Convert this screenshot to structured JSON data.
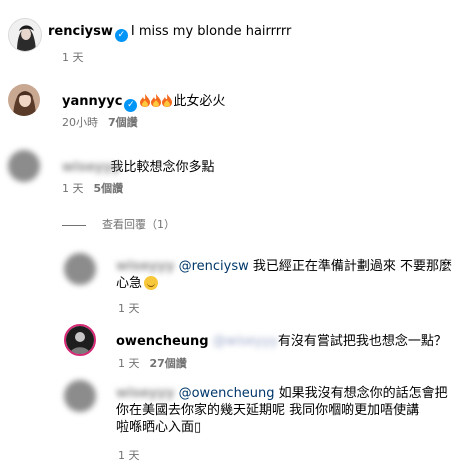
{
  "post": {
    "username": "renciysw",
    "caption": "I miss my blonde hairrrrr",
    "time": "1 天"
  },
  "comments": [
    {
      "username": "yannyyc",
      "text": "此女必火",
      "emoji": "fire-emoji x3",
      "time": "20小時",
      "likes": "7個讚"
    },
    {
      "username": "wiseyyy",
      "text": "我比較想念你多點",
      "time": "1 天",
      "likes": "5個讚",
      "replies_toggle": "查看回覆（1）"
    }
  ],
  "replies": [
    {
      "username": "wiseyyy",
      "mention": "@renciysw",
      "text_line1": " 我已經正在準備計劃過來 不要那麼",
      "text_line2": "心急",
      "emoji": "smiling-face-emoji",
      "time": "1 天"
    },
    {
      "username": "owencheung",
      "blurred_mention": "@wiseyyy",
      "text": "有沒有嘗試把我也想念一點？",
      "time": "1 天",
      "likes": "27個讚"
    },
    {
      "username": "wiseyyy",
      "mention": "@owencheung",
      "text_line1": " 如果我沒有想念你的話怎會把",
      "text_line2": "你在美國去你家的幾天延期呢 我同你嗰啲更加唔使講",
      "text_line3": "啦喺晒心入面▯",
      "time": "1 天"
    }
  ],
  "colors": {
    "verified": "#0095f6",
    "mention": "#00376b",
    "meta": "#737373"
  }
}
